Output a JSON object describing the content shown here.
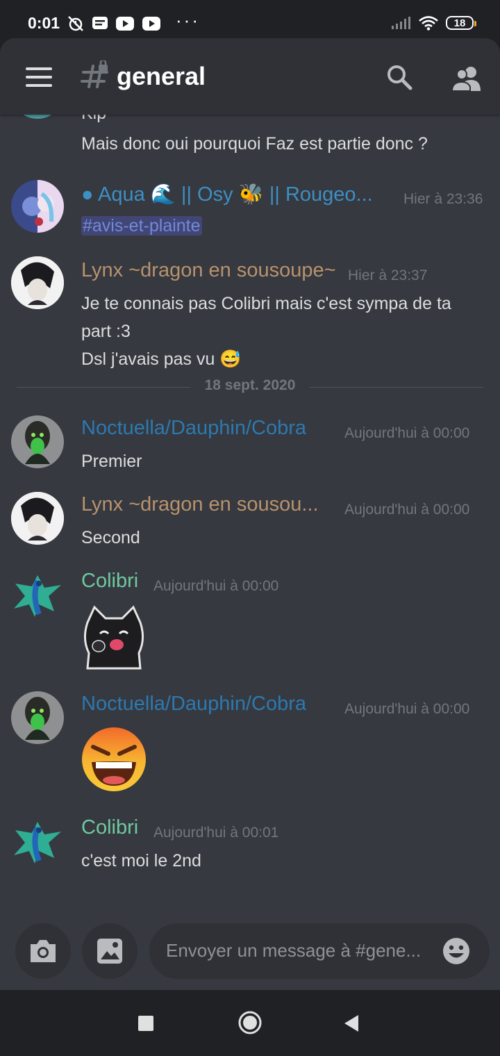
{
  "status_bar": {
    "time": "0:01",
    "more": "···",
    "battery": "18",
    "icons": [
      "alarm-off-icon",
      "message-icon",
      "youtube-icon",
      "youtube-icon",
      "signal-icon",
      "wifi-icon",
      "battery-icon"
    ]
  },
  "header": {
    "channel_name": "general",
    "icons": [
      "menu-icon",
      "locked-channel-hash-icon",
      "search-icon",
      "members-icon"
    ]
  },
  "messages": {
    "partial_top": {
      "text_cut": "Kip",
      "text": "Mais donc oui pourquoi Faz est partie donc ?"
    },
    "m1": {
      "prefix": "● Aqua ",
      "emoji1": "🌊",
      "middle": " || Osy ",
      "emoji2": "🐝",
      "suffix": " || Rougeo...",
      "time": "Hier à 23:36",
      "mention": "#avis-et-plainte",
      "color": "#3d8fc4"
    },
    "m2": {
      "username": "Lynx ~dragon en sousoupe~",
      "time": "Hier à 23:37",
      "line1": "Je te connais pas Colibri mais c'est sympa de ta",
      "line2": "part :3",
      "line3": "Dsl j'avais pas vu ",
      "emoji": "😅",
      "color": "#b8926d"
    },
    "divider": "18 sept. 2020",
    "m3": {
      "username": "Noctuella/Dauphin/Cobra",
      "time": "Aujourd'hui à 00:00",
      "text": "Premier",
      "color": "#2d79b0"
    },
    "m4": {
      "username": "Lynx ~dragon en sousou...",
      "time": "Aujourd'hui à 00:00",
      "text": "Second",
      "color": "#b8926d"
    },
    "m5": {
      "username": "Colibri",
      "time": "Aujourd'hui à 00:00",
      "sticker": "cat-sticker",
      "color": "#70c9a0"
    },
    "m6": {
      "username": "Noctuella/Dauphin/Cobra",
      "time": "Aujourd'hui à 00:00",
      "emoji": "laughing-devil-emoji",
      "color": "#2d79b0"
    },
    "m7": {
      "username": "Colibri",
      "time": "Aujourd'hui à 00:01",
      "text": "c'est moi le 2nd",
      "color": "#70c9a0"
    }
  },
  "input": {
    "placeholder": "Envoyer un message à #gene...",
    "icons": [
      "camera-icon",
      "image-icon",
      "emoji-icon"
    ]
  },
  "nav": {
    "icons": [
      "recents-icon",
      "home-icon",
      "back-icon"
    ]
  }
}
